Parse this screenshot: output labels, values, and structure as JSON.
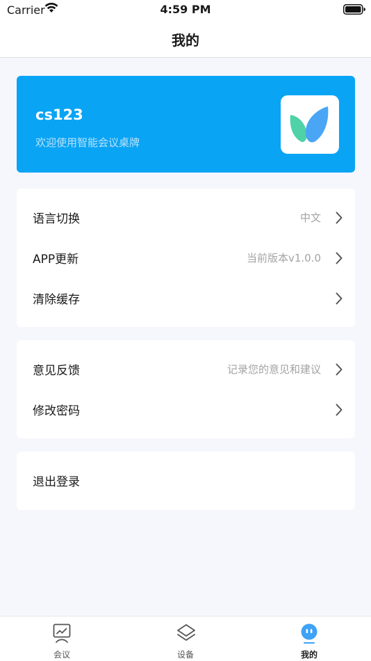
{
  "status_bar": {
    "carrier": "Carrier",
    "time": "4:59 PM"
  },
  "nav": {
    "title": "我的"
  },
  "profile": {
    "username": "cs123",
    "welcome": "欢迎使用智能会议桌牌",
    "logo_icon": "leaf-logo-icon",
    "card_color": "#0aa4f4"
  },
  "settings_group": [
    {
      "label": "语言切换",
      "value": "中文"
    },
    {
      "label": "APP更新",
      "value": "当前版本v1.0.0"
    },
    {
      "label": "清除缓存",
      "value": ""
    }
  ],
  "feedback_group": [
    {
      "label": "意见反馈",
      "value": "记录您的意见和建议"
    },
    {
      "label": "修改密码",
      "value": ""
    }
  ],
  "logout": {
    "label": "退出登录"
  },
  "tabs": [
    {
      "label": "会议",
      "icon": "chart-board-icon",
      "active": false
    },
    {
      "label": "设备",
      "icon": "layers-icon",
      "active": false
    },
    {
      "label": "我的",
      "icon": "face-icon",
      "active": true
    }
  ]
}
